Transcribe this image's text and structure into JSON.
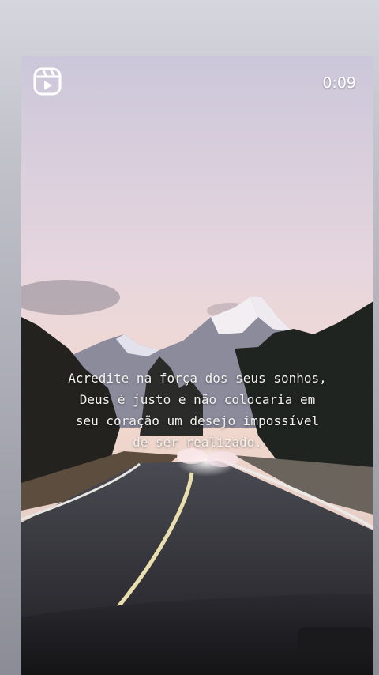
{
  "reel": {
    "icon": "reels-icon",
    "timestamp": "0:09"
  },
  "caption": {
    "lines": [
      "Acredite na força dos seus sonhos,",
      "Deus é justo e não colocaria em",
      "seu coração um desejo impossível",
      "de ser realizado."
    ]
  },
  "colors": {
    "sky_top": "#cfc9dc",
    "sky_bottom": "#f2d8cc",
    "road": "#2a2a2e",
    "center_line": "#e9dfae"
  }
}
